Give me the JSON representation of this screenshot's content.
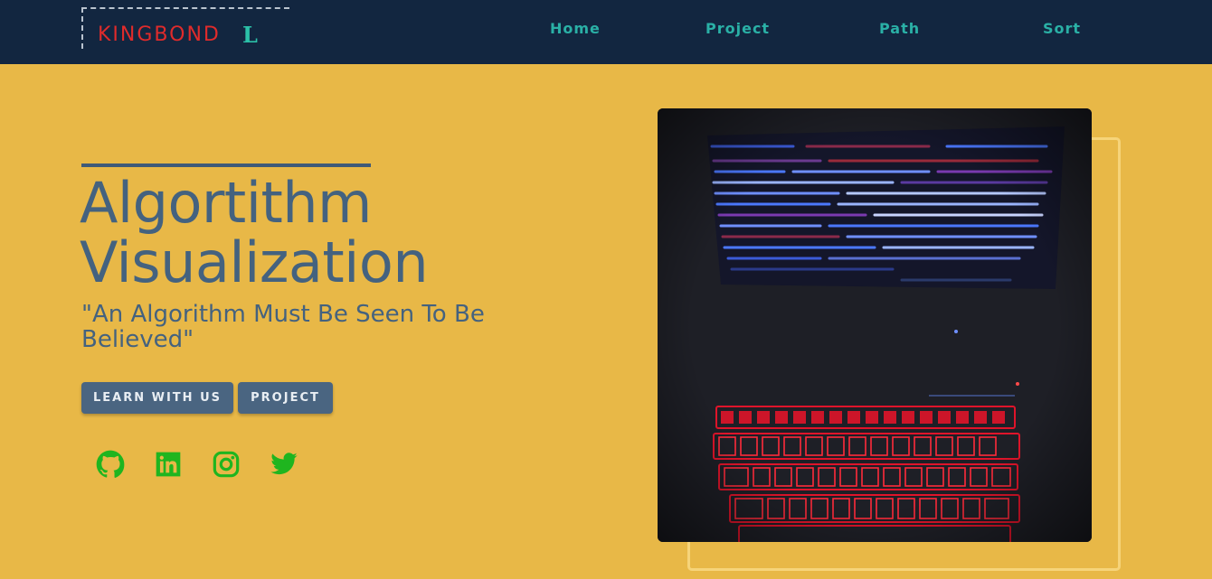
{
  "brand": {
    "name": "KINGBOND",
    "mark": "L"
  },
  "nav": {
    "items": [
      "Home",
      "Project",
      "Path",
      "Sort"
    ]
  },
  "hero": {
    "title_line1": "Algortithm",
    "title_line2": "Visualization",
    "quote": "\"An Algorithm Must Be Seen To Be Believed\""
  },
  "buttons": {
    "learn": "LEARN WITH US",
    "project": "PROJECT"
  },
  "social": [
    "github-icon",
    "linkedin-icon",
    "instagram-icon",
    "twitter-icon"
  ],
  "colors": {
    "background": "#E8B847",
    "navbar": "#122640",
    "brand": "#E02B2B",
    "nav_link": "#2AB0A6",
    "text": "#44627F",
    "button": "#4A6581",
    "social": "#1FB51F",
    "frame": "#F6D47A"
  }
}
